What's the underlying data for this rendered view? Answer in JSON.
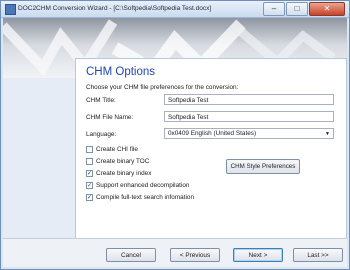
{
  "window": {
    "title": "DOC2CHM Conversion Wizard - [C:\\Softpedia\\Softpedia Test.docx]",
    "minimize_icon": "minimize-icon",
    "maximize_icon": "maximize-icon",
    "close_icon": "close-icon"
  },
  "header": {
    "title": "CHM Options",
    "subtitle": "Choose your CHM file preferences for the conversion:"
  },
  "form": {
    "chm_title_label": "CHM Title:",
    "chm_title_value": "Softpedia Test",
    "chm_file_name_label": "CHM File Name:",
    "chm_file_name_value": "Softpedia Test",
    "language_label": "Language:",
    "language_value": "0x0409 English (United States)"
  },
  "options": [
    {
      "label": "Create CHI file",
      "checked": false
    },
    {
      "label": "Create binary TOC",
      "checked": false
    },
    {
      "label": "Create binary index",
      "checked": true
    },
    {
      "label": "Support enhanced decompilation",
      "checked": true
    },
    {
      "label": "Compile full-text search infomation",
      "checked": true
    }
  ],
  "style_button": "CHM Style Preferences",
  "buttons": {
    "cancel": "Cancel",
    "previous": "< Previous",
    "next": "Next >",
    "last": "Last >>"
  }
}
